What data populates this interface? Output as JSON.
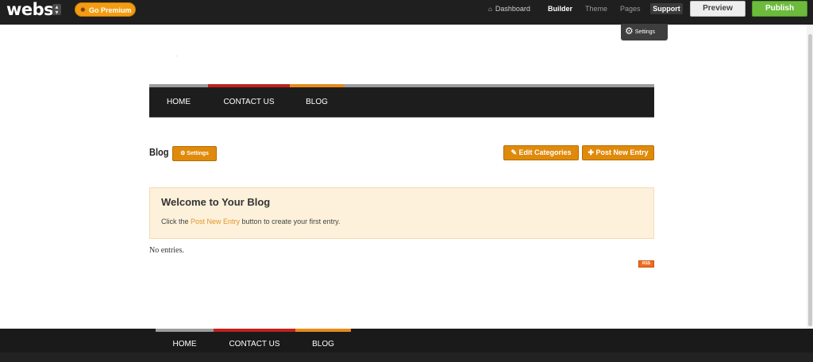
{
  "topbar": {
    "logo": "webs",
    "site_switch_icon": "arrows",
    "premium_label": "Go Premium",
    "nav": {
      "dashboard": "Dashboard",
      "builder": "Builder",
      "theme": "Theme",
      "pages": "Pages",
      "support": "Support"
    },
    "preview_label": "Preview",
    "publish_label": "Publish",
    "settings_label": "Settings"
  },
  "main_nav": {
    "items": [
      "HOME",
      "CONTACT US",
      "BLOG"
    ],
    "strip_colors": [
      "#9c9c9c",
      "#c0221c",
      "#e68a1b"
    ]
  },
  "blog": {
    "title": "Blog",
    "settings_label": "Settings",
    "edit_categories_label": "Edit Categories",
    "post_new_entry_label": "Post New Entry",
    "welcome_title": "Welcome to Your Blog",
    "welcome_text_before": "Click the ",
    "welcome_link": "Post New Entry",
    "welcome_text_after": " button to create your first entry.",
    "no_entries": "No entries.",
    "rss_label": "RSS"
  },
  "footer_nav": {
    "items": [
      "HOME",
      "CONTACT US",
      "BLOG"
    ]
  },
  "colors": {
    "accent_orange": "#e08a0b",
    "publish_green": "#6cbb3c",
    "topbar_bg": "#1f1f1f"
  }
}
